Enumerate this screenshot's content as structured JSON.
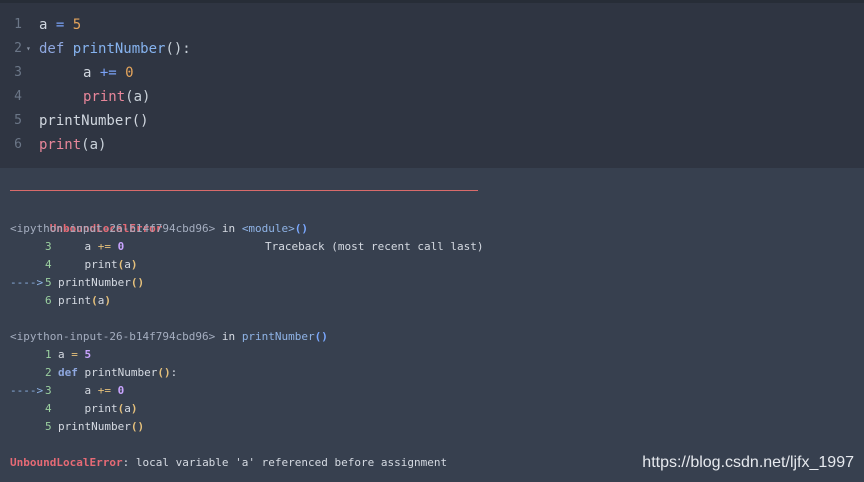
{
  "editor": {
    "lines": [
      {
        "num": "1",
        "tokens": [
          {
            "t": "a",
            "c": "tk-var"
          },
          {
            "t": " = ",
            "c": "tk-op"
          },
          {
            "t": "5",
            "c": "tk-num"
          }
        ]
      },
      {
        "num": "2",
        "fold": "▾",
        "tokens": [
          {
            "t": "def",
            "c": "tk-kw"
          },
          {
            "t": " ",
            "c": "tk-var"
          },
          {
            "t": "printNumber",
            "c": "tk-fn"
          },
          {
            "t": "():",
            "c": "tk-punct"
          }
        ]
      },
      {
        "num": "3",
        "indent": true,
        "tokens": [
          {
            "t": "a",
            "c": "tk-var"
          },
          {
            "t": " += ",
            "c": "tk-op"
          },
          {
            "t": "0",
            "c": "tk-num"
          }
        ]
      },
      {
        "num": "4",
        "indent": true,
        "tokens": [
          {
            "t": "print",
            "c": "tk-builtin"
          },
          {
            "t": "(a)",
            "c": "tk-punct"
          }
        ]
      },
      {
        "num": "5",
        "tokens": [
          {
            "t": "printNumber()",
            "c": "tk-var"
          }
        ]
      },
      {
        "num": "6",
        "tokens": [
          {
            "t": "print",
            "c": "tk-builtin"
          },
          {
            "t": "(a)",
            "c": "tk-punct"
          }
        ]
      }
    ]
  },
  "output": {
    "error_name": "UnboundLocalError",
    "traceback_label": "Traceback (most recent call last)",
    "frame1": {
      "file": "<ipython-input-26-b14f794cbd96>",
      "in_word": " in ",
      "module": "<module>",
      "parens": "()",
      "lines": [
        {
          "arrow": "",
          "num": "3",
          "code": [
            {
              "t": "    a ",
              "c": ""
            },
            {
              "t": "+=",
              "c": "o-op"
            },
            {
              "t": " ",
              "c": ""
            },
            {
              "t": "0",
              "c": "o-num"
            }
          ]
        },
        {
          "arrow": "",
          "num": "4",
          "code": [
            {
              "t": "    print",
              "c": "o-builtin"
            },
            {
              "t": "(",
              "c": "o-paren"
            },
            {
              "t": "a",
              "c": ""
            },
            {
              "t": ")",
              "c": "o-paren"
            }
          ]
        },
        {
          "arrow": "---->",
          "num": "5",
          "code": [
            {
              "t": "printNumber",
              "c": ""
            },
            {
              "t": "()",
              "c": "o-paren"
            }
          ]
        },
        {
          "arrow": "",
          "num": "6",
          "code": [
            {
              "t": "print",
              "c": "o-builtin"
            },
            {
              "t": "(",
              "c": "o-paren"
            },
            {
              "t": "a",
              "c": ""
            },
            {
              "t": ")",
              "c": "o-paren"
            }
          ]
        }
      ]
    },
    "frame2": {
      "file": "<ipython-input-26-b14f794cbd96>",
      "in_word": " in ",
      "func": "printNumber",
      "parens": "()",
      "lines": [
        {
          "arrow": "",
          "num": "1",
          "code": [
            {
              "t": "a ",
              "c": ""
            },
            {
              "t": "=",
              "c": "o-op"
            },
            {
              "t": " ",
              "c": ""
            },
            {
              "t": "5",
              "c": "o-num"
            }
          ]
        },
        {
          "arrow": "",
          "num": "2",
          "code": [
            {
              "t": "def",
              "c": "o-kw"
            },
            {
              "t": " printNumber",
              "c": ""
            },
            {
              "t": "()",
              "c": "o-paren"
            },
            {
              "t": ":",
              "c": ""
            }
          ]
        },
        {
          "arrow": "---->",
          "num": "3",
          "code": [
            {
              "t": "    a ",
              "c": ""
            },
            {
              "t": "+=",
              "c": "o-op"
            },
            {
              "t": " ",
              "c": ""
            },
            {
              "t": "0",
              "c": "o-num"
            }
          ]
        },
        {
          "arrow": "",
          "num": "4",
          "code": [
            {
              "t": "    print",
              "c": "o-builtin"
            },
            {
              "t": "(",
              "c": "o-paren"
            },
            {
              "t": "a",
              "c": ""
            },
            {
              "t": ")",
              "c": "o-paren"
            }
          ]
        },
        {
          "arrow": "",
          "num": "5",
          "code": [
            {
              "t": "printNumber",
              "c": ""
            },
            {
              "t": "()",
              "c": "o-paren"
            }
          ]
        }
      ]
    },
    "final_message": ": local variable 'a' referenced before assignment"
  },
  "watermark": "https://blog.csdn.net/ljfx_1997"
}
